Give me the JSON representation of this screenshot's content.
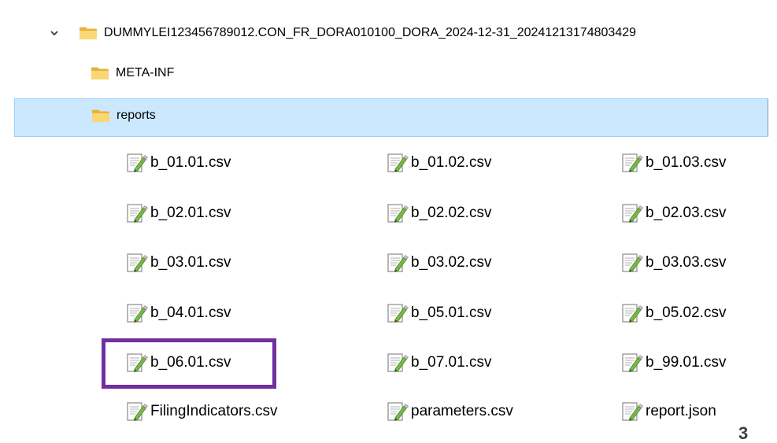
{
  "tree": {
    "root": {
      "label": "DUMMYLEI123456789012.CON_FR_DORA010100_DORA_2024-12-31_20241213174803429",
      "icon": "folder-icon",
      "expanded": true
    },
    "meta_inf": {
      "label": "META-INF",
      "icon": "folder-icon"
    },
    "reports": {
      "label": "reports",
      "icon": "folder-icon",
      "selected": true
    }
  },
  "files": [
    {
      "label": "b_01.01.csv",
      "icon": "csv-file-icon"
    },
    {
      "label": "b_01.02.csv",
      "icon": "csv-file-icon"
    },
    {
      "label": "b_01.03.csv",
      "icon": "csv-file-icon"
    },
    {
      "label": "b_02.01.csv",
      "icon": "csv-file-icon"
    },
    {
      "label": "b_02.02.csv",
      "icon": "csv-file-icon"
    },
    {
      "label": "b_02.03.csv",
      "icon": "csv-file-icon"
    },
    {
      "label": "b_03.01.csv",
      "icon": "csv-file-icon"
    },
    {
      "label": "b_03.02.csv",
      "icon": "csv-file-icon"
    },
    {
      "label": "b_03.03.csv",
      "icon": "csv-file-icon"
    },
    {
      "label": "b_04.01.csv",
      "icon": "csv-file-icon"
    },
    {
      "label": "b_05.01.csv",
      "icon": "csv-file-icon"
    },
    {
      "label": "b_05.02.csv",
      "icon": "csv-file-icon"
    },
    {
      "label": "b_06.01.csv",
      "icon": "csv-file-icon",
      "highlighted": true
    },
    {
      "label": "b_07.01.csv",
      "icon": "csv-file-icon"
    },
    {
      "label": "b_99.01.csv",
      "icon": "csv-file-icon"
    },
    {
      "label": "FilingIndicators.csv",
      "icon": "csv-file-icon"
    },
    {
      "label": "parameters.csv",
      "icon": "csv-file-icon"
    },
    {
      "label": "report.json",
      "icon": "json-file-icon"
    }
  ],
  "colors": {
    "selection_bg": "#cce8ff",
    "selection_border": "#99d1ff",
    "highlight_border": "#7030a0",
    "folder": "#f8d775"
  },
  "page_number": "3"
}
